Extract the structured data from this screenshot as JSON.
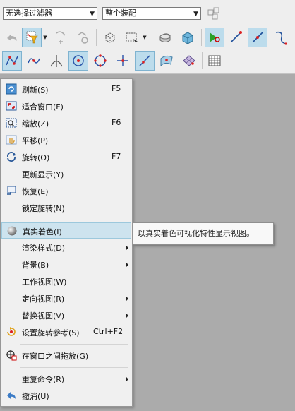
{
  "toolbar": {
    "filter_select": "无选择过滤器",
    "scope_select": "整个装配"
  },
  "menu": {
    "items": [
      {
        "label": "刷新(S)",
        "shortcut": "F5"
      },
      {
        "label": "适合窗口(F)",
        "shortcut": ""
      },
      {
        "label": "缩放(Z)",
        "shortcut": "F6"
      },
      {
        "label": "平移(P)",
        "shortcut": ""
      },
      {
        "label": "旋转(O)",
        "shortcut": "F7"
      },
      {
        "label": "更新显示(Y)",
        "shortcut": ""
      },
      {
        "label": "恢复(E)",
        "shortcut": ""
      },
      {
        "label": "锁定旋转(N)",
        "shortcut": ""
      },
      {
        "label": "真实着色(I)",
        "shortcut": ""
      },
      {
        "label": "渲染样式(D)",
        "shortcut": ""
      },
      {
        "label": "背景(B)",
        "shortcut": ""
      },
      {
        "label": "工作视图(W)",
        "shortcut": ""
      },
      {
        "label": "定向视图(R)",
        "shortcut": ""
      },
      {
        "label": "替换视图(V)",
        "shortcut": ""
      },
      {
        "label": "设置旋转参考(S)",
        "shortcut": "Ctrl+F2"
      },
      {
        "label": "在窗口之间拖放(G)",
        "shortcut": ""
      },
      {
        "label": "重复命令(R)",
        "shortcut": ""
      },
      {
        "label": "撤消(U)",
        "shortcut": ""
      }
    ]
  },
  "tooltip": {
    "text": "以真实着色可视化特性显示视图。"
  },
  "colors": {
    "highlight": "#cde3ee",
    "active_tool": "#bcdcec",
    "workspace": "#ababab"
  }
}
